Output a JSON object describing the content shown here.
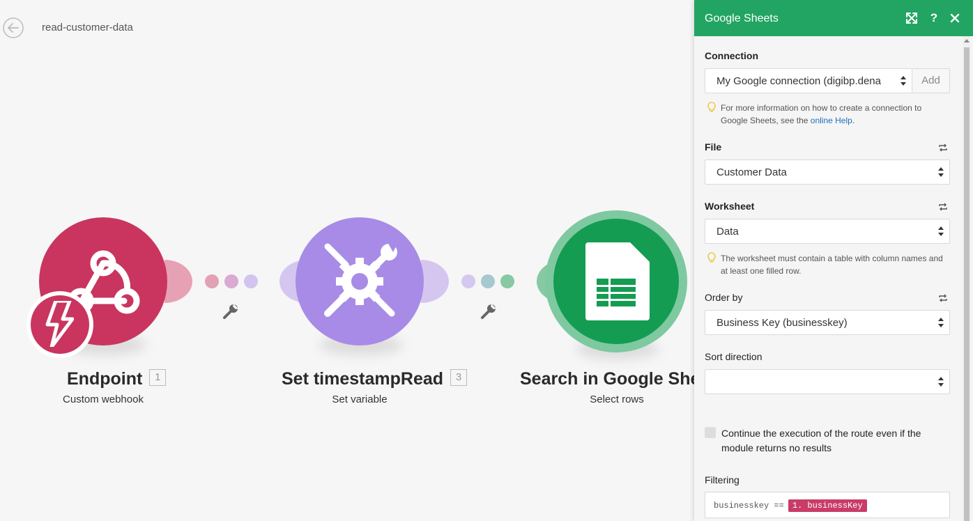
{
  "header": {
    "scenario_name": "read-customer-data"
  },
  "modules": [
    {
      "title": "Endpoint",
      "id": "1",
      "subtitle": "Custom webhook"
    },
    {
      "title": "Set timestampRead",
      "id": "3",
      "subtitle": "Set variable"
    },
    {
      "title": "Search in Google Shee",
      "subtitle": "Select rows"
    }
  ],
  "panel": {
    "title": "Google Sheets",
    "connection": {
      "label": "Connection",
      "value": "My Google connection (digibp.dena",
      "add_label": "Add",
      "hint_prefix": "For more information on how to create a connection to Google Sheets, see the ",
      "hint_link": "online Help",
      "hint_suffix": "."
    },
    "file": {
      "label": "File",
      "value": "Customer Data"
    },
    "worksheet": {
      "label": "Worksheet",
      "value": "Data",
      "hint": "The worksheet must contain a table with column names and at least one filled row."
    },
    "order_by": {
      "label": "Order by",
      "value": "Business Key (businesskey)"
    },
    "sort_direction": {
      "label": "Sort direction",
      "value": ""
    },
    "continue_option": {
      "label": "Continue the execution of the route even if the module returns no results"
    },
    "filtering": {
      "label": "Filtering",
      "expression": "businesskey ==",
      "token": "1. businessKey"
    }
  },
  "colors": {
    "webhook": "#c9355f",
    "tools": "#a88be6",
    "sheets": "#149c52",
    "panel_header": "#22a562"
  }
}
